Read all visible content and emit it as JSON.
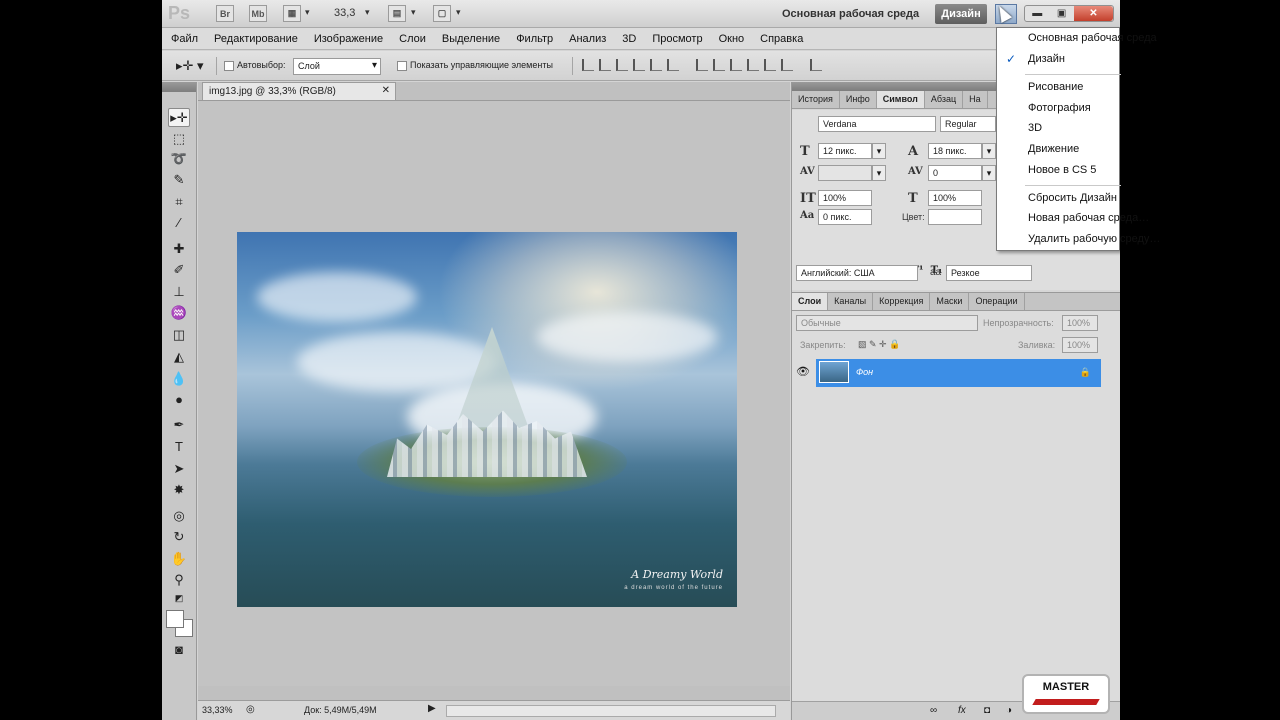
{
  "appbar": {
    "logo": "Ps",
    "bridge": "Br",
    "mini_bridge": "Mb",
    "zoom": "33,3",
    "workspace_label": "Основная рабочая среда",
    "workspace_active": "Дизайн"
  },
  "menu": [
    "Файл",
    "Редактирование",
    "Изображение",
    "Слои",
    "Выделение",
    "Фильтр",
    "Анализ",
    "3D",
    "Просмотр",
    "Окно",
    "Справка"
  ],
  "options": {
    "autoselect_label": "Автовыбор:",
    "autoselect_value": "Слой",
    "show_controls_label": "Показать управляющие элементы"
  },
  "document": {
    "tab_title": "img13.jpg @ 33,3% (RGB/8)",
    "close": "✕",
    "caption": "A Dreamy World",
    "caption_sub": "a dream world of the future",
    "status_zoom": "33,33%",
    "status_doc": "Док: 5,49M/5,49M"
  },
  "panel_tabs_top": [
    "История",
    "Инфо",
    "Символ",
    "Абзац",
    "На"
  ],
  "character": {
    "font_family": "Verdana",
    "font_style": "Regular",
    "size": "12 пикс.",
    "leading": "18 пикс.",
    "kerning": "",
    "tracking": "0",
    "vscale": "100%",
    "hscale": "100%",
    "baseline": "0 пикс.",
    "color_label": "Цвет:",
    "language": "Английский: США",
    "antialias": "Резкое",
    "aa_icon": "aa",
    "style_buttons": [
      "T",
      "T",
      "TT",
      "Tт",
      "T¹",
      "T₁",
      "T",
      "T"
    ]
  },
  "layer_tabs": [
    "Слои",
    "Каналы",
    "Коррекция",
    "Маски",
    "Операции"
  ],
  "layers": {
    "blend_mode": "Обычные",
    "opacity_label": "Непрозрачность:",
    "opacity_value": "100%",
    "lock_label": "Закрепить:",
    "fill_label": "Заливка:",
    "fill_value": "100%",
    "items": [
      {
        "name": "Фон"
      }
    ]
  },
  "workspace_menu": {
    "items": [
      "Основная рабочая среда",
      "Дизайн",
      "Рисование",
      "Фотография",
      "3D",
      "Движение",
      "Новое в CS 5",
      "Сбросить Дизайн",
      "Новая рабочая среда…",
      "Удалить рабочую среду…"
    ],
    "checked": "Дизайн"
  },
  "watermark": "MASTER"
}
